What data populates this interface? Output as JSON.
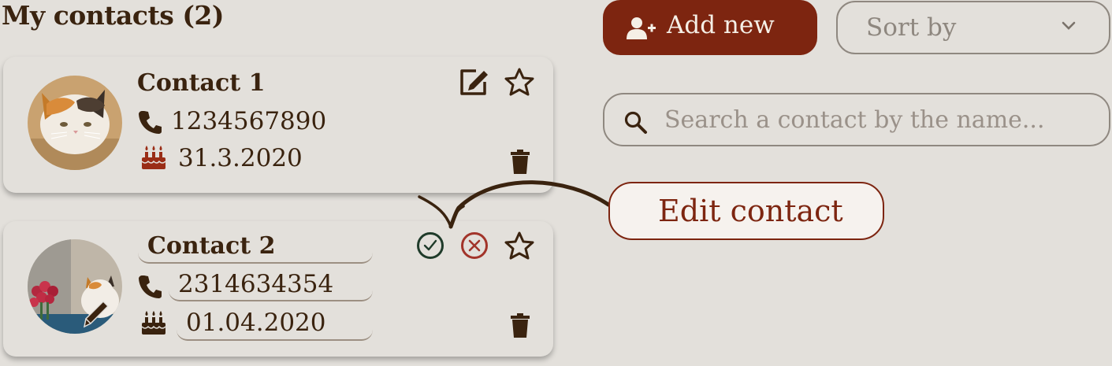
{
  "header": {
    "title": "My contacts (2)"
  },
  "toolbar": {
    "add_label": "Add new",
    "sort_label": "Sort by",
    "search_placeholder": "Search a contact by the name..."
  },
  "contacts": [
    {
      "name": "Contact 1",
      "phone": "1234567890",
      "birthday": "31.3.2020",
      "mode": "view"
    },
    {
      "name": "Contact 2",
      "phone": "2314634354",
      "birthday": "01.04.2020",
      "mode": "edit"
    }
  ],
  "tooltip": {
    "label": "Edit contact"
  },
  "colors": {
    "background": "#e3e0db",
    "primary": "#7d2510",
    "text": "#3a230f",
    "confirm": "#1f3b2a",
    "cancel": "#a2342a"
  },
  "icons": [
    "user-plus-icon",
    "chevron-down-icon",
    "search-icon",
    "phone-icon",
    "cake-icon",
    "edit-icon",
    "star-icon",
    "trash-icon",
    "check-circle-icon",
    "cancel-circle-icon",
    "pencil-icon"
  ]
}
